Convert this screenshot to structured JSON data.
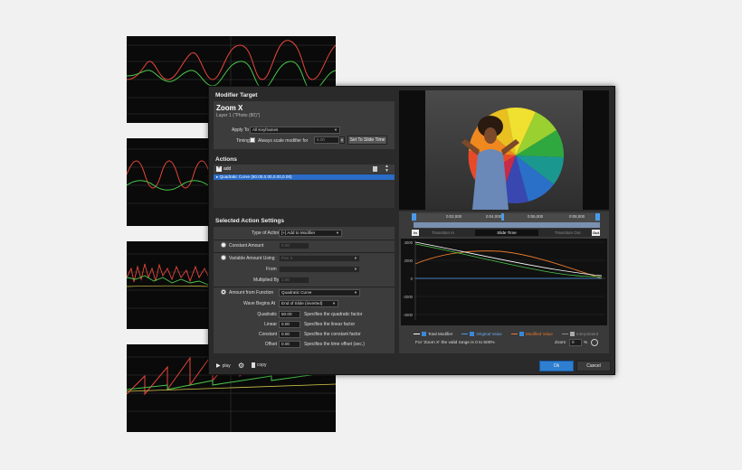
{
  "thumbs": [
    {
      "top": 40
    },
    {
      "top": 153
    },
    {
      "top": 267
    },
    {
      "top": 381
    }
  ],
  "modifier_target": {
    "title": "Modifier Target",
    "name": "Zoom X",
    "layer": "Layer 1 (\"Photo (80)\")",
    "apply_to_label": "Apply To",
    "apply_to_value": "All Keyframes",
    "timing_label": "Timing",
    "always_scale_label": "Always scale modifier for",
    "scale_value": "5.00",
    "set_to_slide_time": "Set To Slide Time"
  },
  "actions": {
    "title": "Actions",
    "add_label": "add",
    "items": [
      "Quadratic Curve (50.00,0.00,0.00,0.00)"
    ]
  },
  "settings": {
    "title": "Selected Action Settings",
    "type_label": "Type of Action",
    "type_value": "[+] Add to Modifier",
    "constant_label": "Constant Amount",
    "constant_value": "0.00",
    "variable_label": "Variable Amount Using",
    "variable_value": "Pan X",
    "from_label": "From",
    "from_value": "",
    "multiplied_label": "Multiplied By",
    "multiplied_value": "1.00",
    "function_label": "Amount from Function",
    "function_value": "Quadratic Curve",
    "wave_label": "Wave Begins At",
    "wave_value": "End of Slide (inverted)",
    "params": [
      {
        "label": "Quadratic",
        "value": "50.00",
        "desc": "Specifies the quadratic factor"
      },
      {
        "label": "Linear",
        "value": "0.00",
        "desc": "Specifies the linear factor"
      },
      {
        "label": "Constant",
        "value": "0.00",
        "desc": "Specifies the constant factor"
      },
      {
        "label": "Offset",
        "value": "0.00",
        "desc": "Specifies the time offset (sec.)"
      }
    ]
  },
  "timeline": {
    "ticks": [
      "0:02,000",
      "0:04,000",
      "0:06,000",
      "0:08,000"
    ],
    "in_marker": "In",
    "out_marker": "Out",
    "transition_in": "Transition In",
    "slide_time": "Slide Time",
    "transition_out": "Transition Out"
  },
  "graph": {
    "y_ticks": [
      "4000",
      "2000",
      "0",
      "-2000",
      "-4000"
    ],
    "legend": [
      {
        "name": "Total Modifier",
        "color": "#ffffff"
      },
      {
        "name": "Original Value",
        "color": "#4a9ae8"
      },
      {
        "name": "Modified Value",
        "color": "#e87a2a"
      },
      {
        "name": "Interpolated",
        "color": "#888888"
      }
    ],
    "range_note": "For 'Zoom X' the valid range is 0 to 500%",
    "zoom_label": "Zoom",
    "zoom_value": "0",
    "zoom_unit": "%"
  },
  "footer": {
    "play": "play",
    "copy": "copy",
    "ok": "Ok",
    "cancel": "Cancel"
  },
  "colors": {
    "accent": "#2f7fd0",
    "selection": "#2a6cc8"
  }
}
